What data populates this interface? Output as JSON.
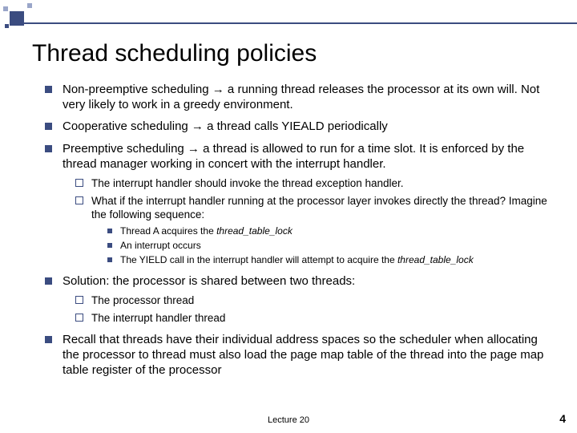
{
  "title": "Thread scheduling policies",
  "bullets": {
    "b1": "Non-preemptive scheduling → a running thread releases the processor at its own will. Not very likely to work in a greedy environment.",
    "b2": "Cooperative scheduling → a thread calls YIEALD periodically",
    "b3": "Preemptive scheduling → a thread is allowed to run for a time slot. It is enforced  by the thread manager working in concert with the interrupt handler.",
    "b3_s1": "The interrupt handler should invoke the thread exception handler.",
    "b3_s2": "What if the interrupt handler running at the processor layer invokes directly the thread?  Imagine the following sequence:",
    "b3_s2_a_pre": "Thread A acquires the ",
    "b3_s2_a_ital": "thread_table_lock",
    "b3_s2_b": "An interrupt occurs",
    "b3_s2_c_pre": "The YIELD call in the interrupt handler will attempt to acquire the ",
    "b3_s2_c_ital": "thread_table_lock",
    "b4": "Solution: the processor is shared between two threads:",
    "b4_s1": "The processor thread",
    "b4_s2": "The interrupt handler thread",
    "b5": "Recall that threads have their individual address spaces so the scheduler when allocating the processor to  thread must also load the page map table of the thread into the page map table register of the processor"
  },
  "footer": {
    "center": "Lecture 20",
    "page": "4"
  }
}
